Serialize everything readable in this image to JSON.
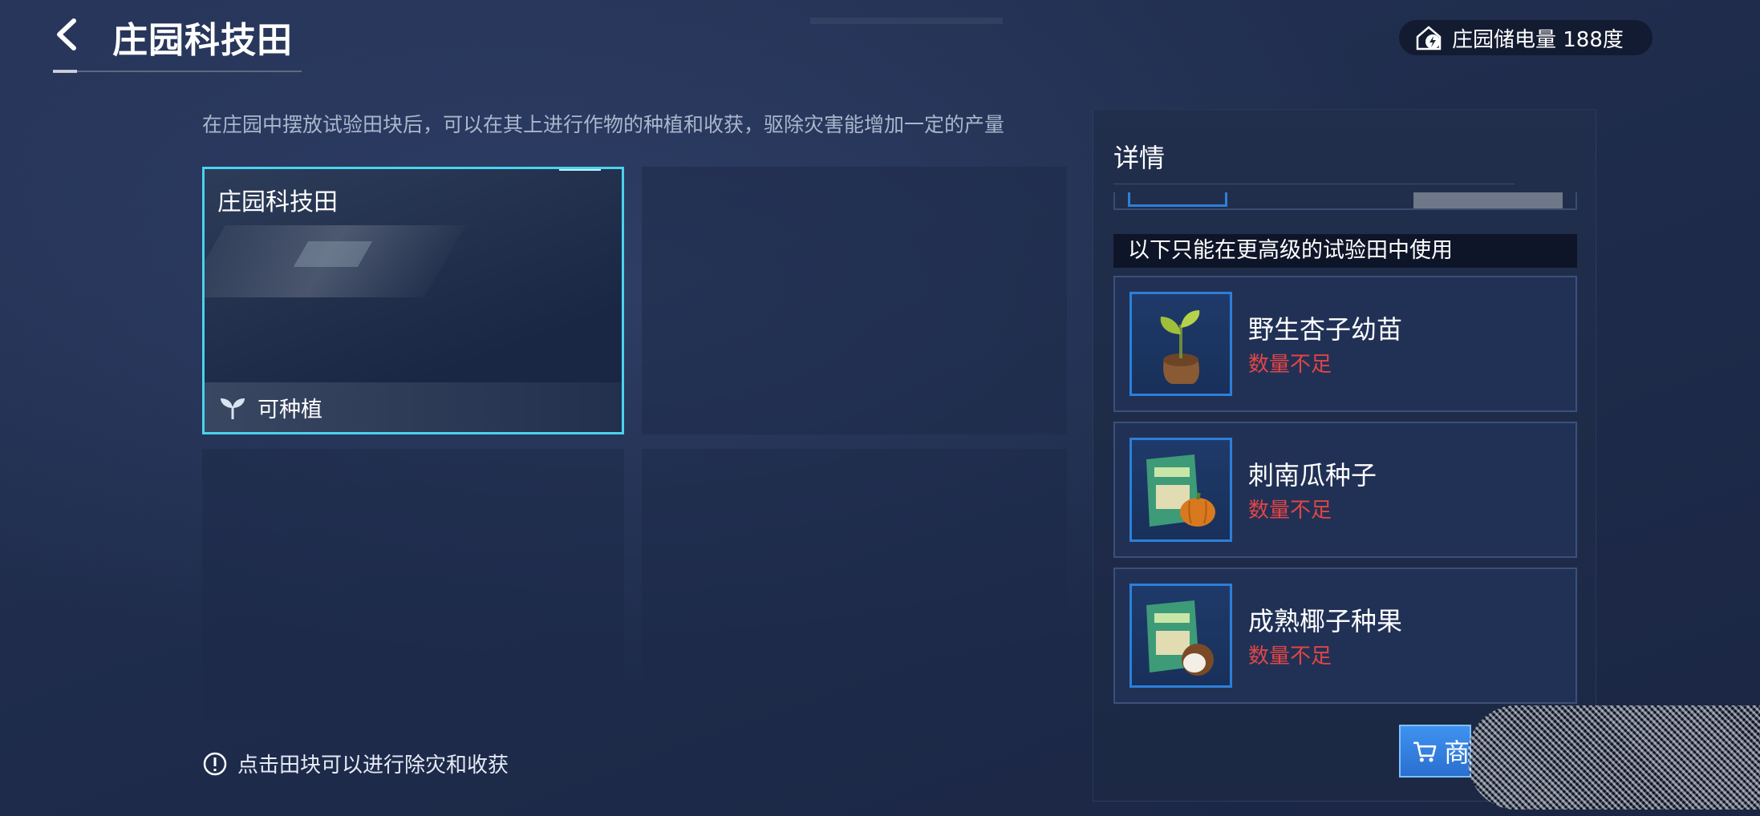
{
  "header": {
    "title": "庄园科技田",
    "energy_label": "庄园储电量 188度"
  },
  "description": "在庄园中摆放试验田块后，可以在其上进行作物的种植和收获，驱除灾害能增加一定的产量",
  "plot": {
    "name": "庄园科技田",
    "status": "可种植"
  },
  "hint": "点击田块可以进行除灾和收获",
  "panel": {
    "title": "详情",
    "section_header": "以下只能在更高级的试验田中使用",
    "items": [
      {
        "name": "野生杏子幼苗",
        "qty_status": "数量不足",
        "icon": "sapling-icon"
      },
      {
        "name": "刺南瓜种子",
        "qty_status": "数量不足",
        "icon": "pumpkin-seed-pack-icon"
      },
      {
        "name": "成熟椰子种果",
        "qty_status": "数量不足",
        "icon": "coconut-seed-pack-icon"
      }
    ],
    "shop_label": "商"
  },
  "colors": {
    "accent": "#4ad3ee",
    "warning": "#e24545",
    "button": "#2a6fd0"
  }
}
